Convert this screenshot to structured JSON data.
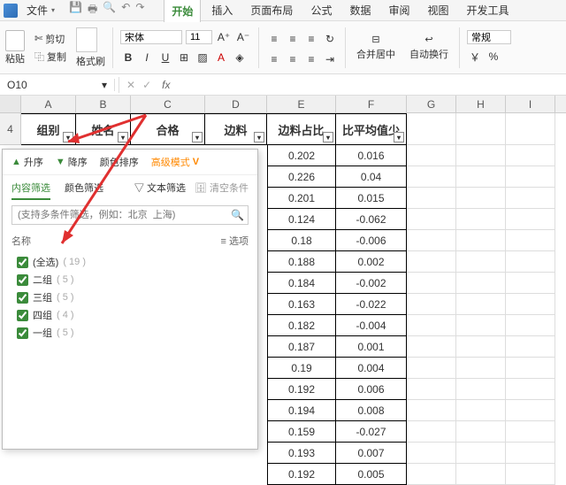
{
  "menubar": {
    "file": "文件",
    "tabs": [
      "开始",
      "插入",
      "页面布局",
      "公式",
      "数据",
      "审阅",
      "视图",
      "开发工具"
    ]
  },
  "ribbon": {
    "paste": "粘贴",
    "cut": "剪切",
    "copy": "复制",
    "fmt": "格式刷",
    "font_name": "宋体",
    "font_size": "11",
    "merge": "合并居中",
    "wrap": "自动换行",
    "style": "常规"
  },
  "fbar": {
    "namebox": "O10",
    "fx": "fx"
  },
  "columns": [
    "A",
    "B",
    "C",
    "D",
    "E",
    "F",
    "G",
    "H",
    "I"
  ],
  "row4_header": "4",
  "headers": {
    "A": "组别",
    "B": "姓名",
    "C": "合格",
    "D": "边料",
    "E": "边料占比",
    "F": "比平均值少"
  },
  "data": [
    {
      "E": "0.202",
      "F": "0.016"
    },
    {
      "E": "0.226",
      "F": "0.04"
    },
    {
      "E": "0.201",
      "F": "0.015"
    },
    {
      "E": "0.124",
      "F": "-0.062"
    },
    {
      "E": "0.18",
      "F": "-0.006"
    },
    {
      "E": "0.188",
      "F": "0.002"
    },
    {
      "E": "0.184",
      "F": "-0.002"
    },
    {
      "E": "0.163",
      "F": "-0.022"
    },
    {
      "E": "0.182",
      "F": "-0.004"
    },
    {
      "E": "0.187",
      "F": "0.001"
    },
    {
      "E": "0.19",
      "F": "0.004"
    },
    {
      "E": "0.192",
      "F": "0.006"
    },
    {
      "E": "0.194",
      "F": "0.008"
    },
    {
      "E": "0.159",
      "F": "-0.027"
    },
    {
      "E": "0.193",
      "F": "0.007"
    },
    {
      "E": "0.192",
      "F": "0.005"
    }
  ],
  "filter": {
    "asc": "升序",
    "desc": "降序",
    "color_sort": "颜色排序",
    "adv": "高级模式",
    "tab_content": "内容筛选",
    "tab_color": "颜色筛选",
    "text_filter": "文本筛选",
    "clear": "清空条件",
    "search_ph": "(支持多条件筛选，例如：北京  上海)",
    "name_col": "名称",
    "options": "选项",
    "items": [
      {
        "label": "(全选)",
        "count": "( 19 )"
      },
      {
        "label": "二组",
        "count": "( 5 )"
      },
      {
        "label": "三组",
        "count": "( 5 )"
      },
      {
        "label": "四组",
        "count": "( 4 )"
      },
      {
        "label": "一组",
        "count": "( 5 )"
      }
    ]
  }
}
